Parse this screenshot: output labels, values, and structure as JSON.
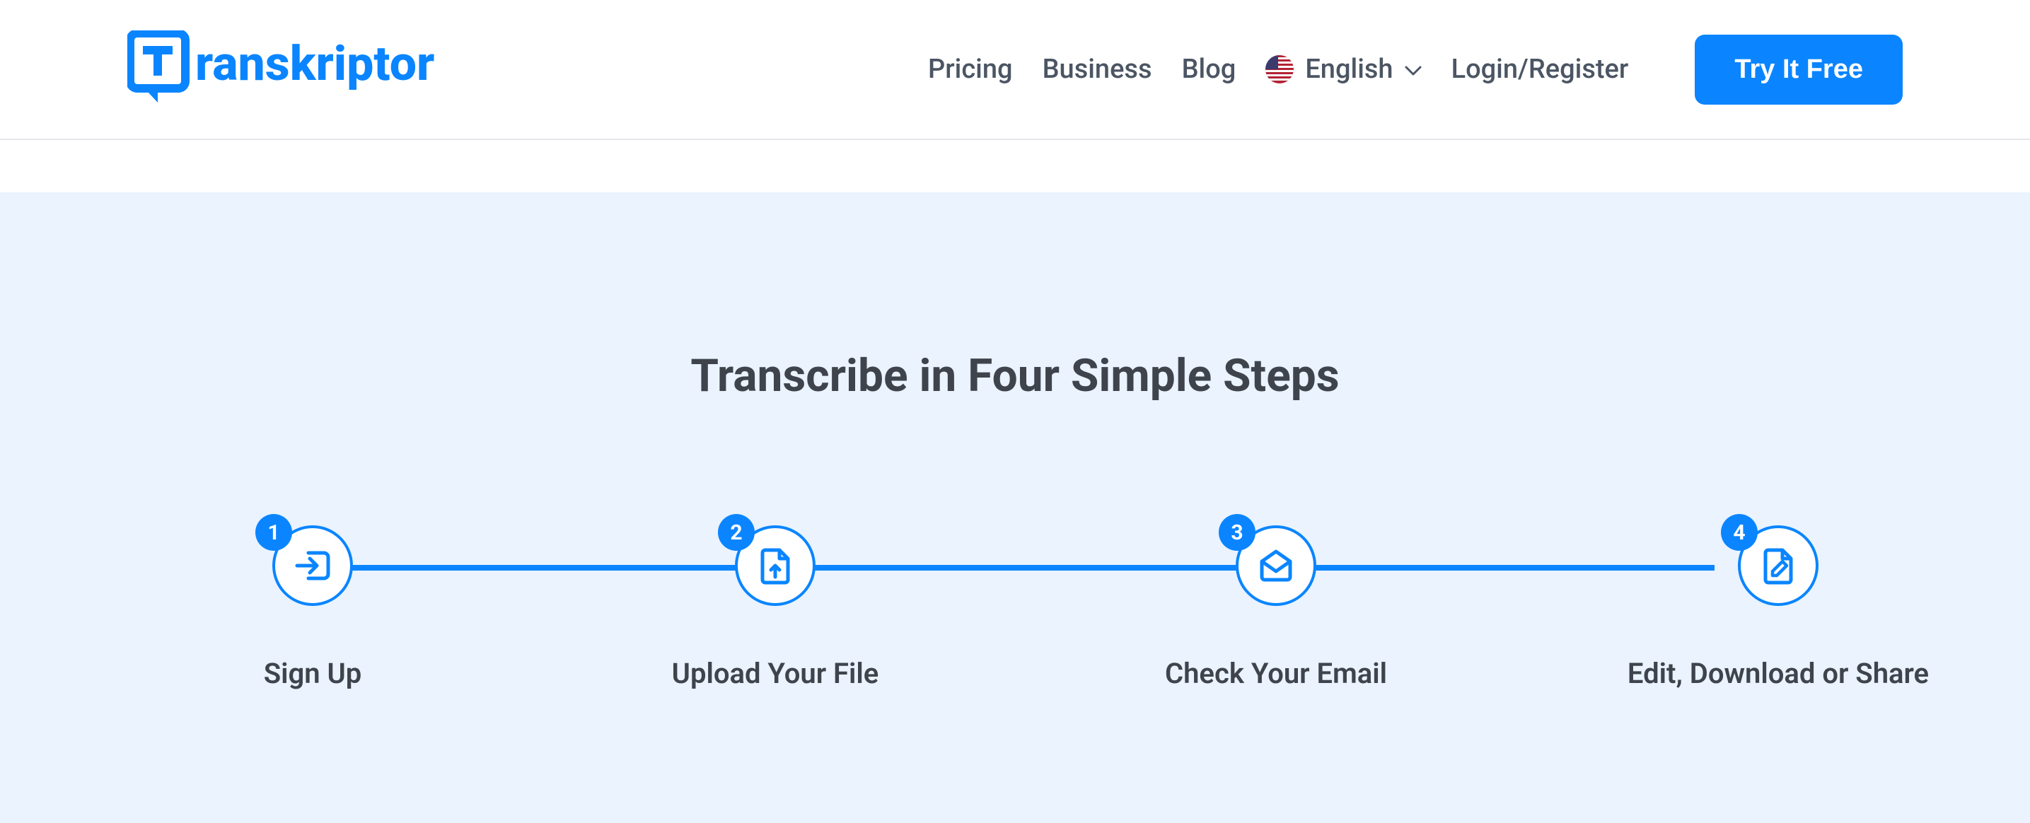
{
  "brand": {
    "name": "Transkriptor"
  },
  "nav": {
    "pricing": "Pricing",
    "business": "Business",
    "blog": "Blog",
    "language": "English",
    "login": "Login/Register",
    "cta": "Try It Free"
  },
  "hero": {
    "title": "Transcribe in Four Simple Steps"
  },
  "steps": [
    {
      "num": "1",
      "label": "Sign Up",
      "icon": "signin-icon"
    },
    {
      "num": "2",
      "label": "Upload Your File",
      "icon": "upload-file-icon"
    },
    {
      "num": "3",
      "label": "Check Your Email",
      "icon": "email-icon"
    },
    {
      "num": "4",
      "label": "Edit, Download or Share",
      "icon": "edit-file-icon"
    }
  ]
}
